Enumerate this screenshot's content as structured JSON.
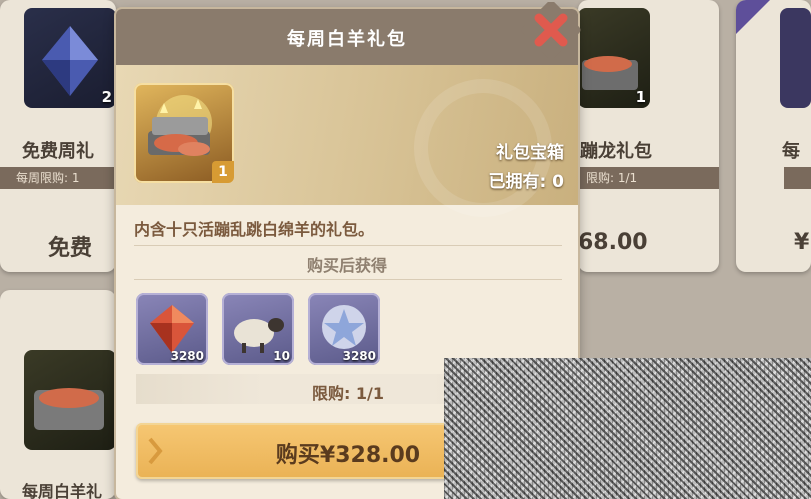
{
  "dialog": {
    "title": "每周白羊礼包",
    "item": {
      "count": "1",
      "type_label": "礼包宝箱",
      "owned_label": "已拥有: 0"
    },
    "description": "内含十只活蹦乱跳白绵羊的礼包。",
    "rewards_title": "购买后获得",
    "rewards": [
      {
        "icon": "red-gem-icon",
        "quantity": "3280"
      },
      {
        "icon": "sheep-icon",
        "quantity": "10"
      },
      {
        "icon": "star-medallion-icon",
        "quantity": "3280"
      }
    ],
    "limit_label": "限购: 1/1",
    "buy_label": "购买¥328.00",
    "close_icon": "close-x-icon"
  },
  "background": {
    "left_card": {
      "count": "2",
      "title": "免费周礼",
      "limit": "每周限购: 1",
      "price": "免费"
    },
    "right_card": {
      "count": "1",
      "title": "蹦龙礼包",
      "limit": "限购: 1/1",
      "price": "68.00"
    },
    "far_right_card": {
      "title": "每",
      "limit": "",
      "price": "¥"
    },
    "bottom_left_card": {
      "title": "每周白羊礼"
    }
  },
  "colors": {
    "accent": "#eab255",
    "header": "#8a7b6c",
    "panel": "#f4ecdd",
    "text_brown": "#7b5a3e",
    "close_red": "#e05a4e"
  }
}
